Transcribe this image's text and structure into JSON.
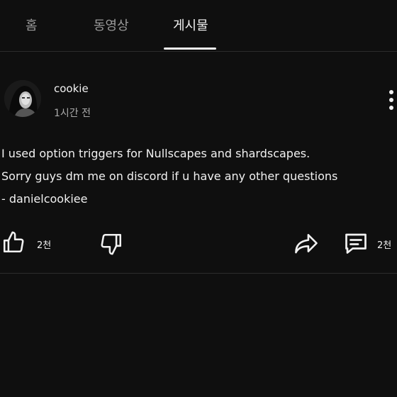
{
  "tabs": [
    {
      "label": "홈"
    },
    {
      "label": "동영상"
    },
    {
      "label": "게시물"
    }
  ],
  "post": {
    "author": "cookie",
    "time": "1시간 전",
    "lines": [
      "I used option triggers for Nullscapes and shardscapes.",
      "Sorry guys dm me on discord if u have any other questions",
      "- danielcookiee"
    ],
    "like_count": "2천",
    "comment_count": "2천"
  },
  "colors": {
    "background": "#0f0f0f",
    "text": "#f1f1f1",
    "muted": "#9a9a9a",
    "divider": "#2c2c2c"
  },
  "icons": [
    "thumbs-up-icon",
    "thumbs-down-icon",
    "share-icon",
    "comment-icon",
    "more-vertical-icon"
  ]
}
